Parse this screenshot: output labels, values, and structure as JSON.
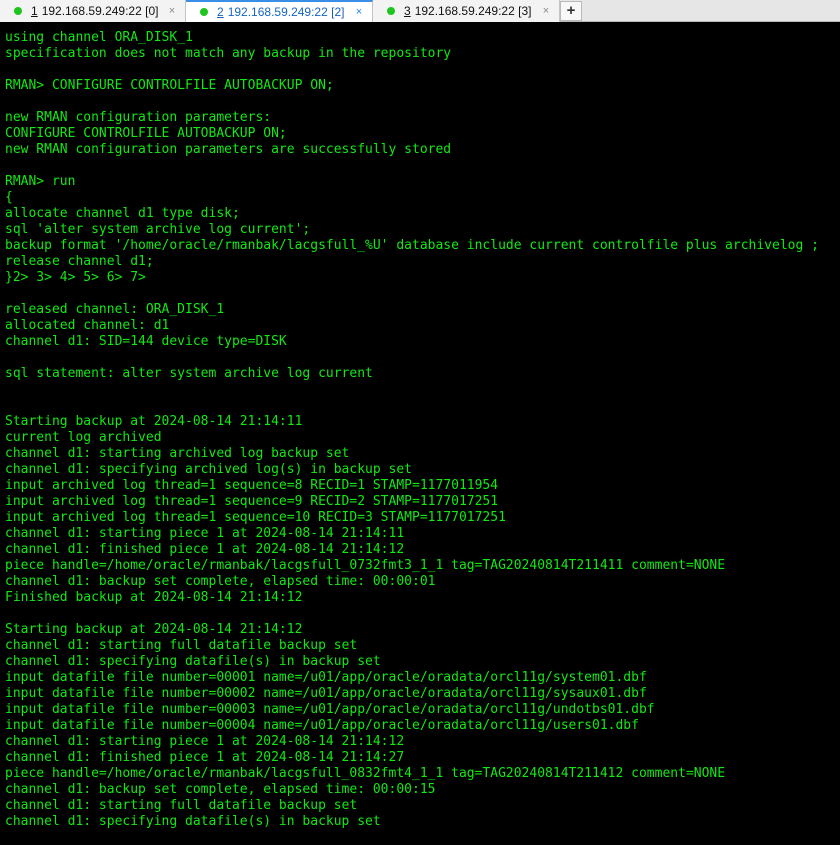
{
  "tabs": [
    {
      "number": "1",
      "label": "192.168.59.249:22 [0]",
      "close": "×",
      "status_color": "#1ec51e",
      "active": false
    },
    {
      "number": "2",
      "label": "192.168.59.249:22 [2]",
      "close": "×",
      "status_color": "#1ec51e",
      "active": true
    },
    {
      "number": "3",
      "label": "192.168.59.249:22 [3]",
      "close": "×",
      "status_color": "#1ec51e",
      "active": false
    }
  ],
  "new_tab_label": "+",
  "terminal": {
    "text_color": "#13e813",
    "background": "#000000",
    "lines": [
      "using channel ORA_DISK_1",
      "specification does not match any backup in the repository",
      "",
      "RMAN> CONFIGURE CONTROLFILE AUTOBACKUP ON;",
      "",
      "new RMAN configuration parameters:",
      "CONFIGURE CONTROLFILE AUTOBACKUP ON;",
      "new RMAN configuration parameters are successfully stored",
      "",
      "RMAN> run",
      "{",
      "allocate channel d1 type disk;",
      "sql 'alter system archive log current';",
      "backup format '/home/oracle/rmanbak/lacgsfull_%U' database include current controlfile plus archivelog ;",
      "release channel d1;",
      "}2> 3> 4> 5> 6> 7>",
      "",
      "released channel: ORA_DISK_1",
      "allocated channel: d1",
      "channel d1: SID=144 device type=DISK",
      "",
      "sql statement: alter system archive log current",
      "",
      "",
      "Starting backup at 2024-08-14 21:14:11",
      "current log archived",
      "channel d1: starting archived log backup set",
      "channel d1: specifying archived log(s) in backup set",
      "input archived log thread=1 sequence=8 RECID=1 STAMP=1177011954",
      "input archived log thread=1 sequence=9 RECID=2 STAMP=1177017251",
      "input archived log thread=1 sequence=10 RECID=3 STAMP=1177017251",
      "channel d1: starting piece 1 at 2024-08-14 21:14:11",
      "channel d1: finished piece 1 at 2024-08-14 21:14:12",
      "piece handle=/home/oracle/rmanbak/lacgsfull_0732fmt3_1_1 tag=TAG20240814T211411 comment=NONE",
      "channel d1: backup set complete, elapsed time: 00:00:01",
      "Finished backup at 2024-08-14 21:14:12",
      "",
      "Starting backup at 2024-08-14 21:14:12",
      "channel d1: starting full datafile backup set",
      "channel d1: specifying datafile(s) in backup set",
      "input datafile file number=00001 name=/u01/app/oracle/oradata/orcl11g/system01.dbf",
      "input datafile file number=00002 name=/u01/app/oracle/oradata/orcl11g/sysaux01.dbf",
      "input datafile file number=00003 name=/u01/app/oracle/oradata/orcl11g/undotbs01.dbf",
      "input datafile file number=00004 name=/u01/app/oracle/oradata/orcl11g/users01.dbf",
      "channel d1: starting piece 1 at 2024-08-14 21:14:12",
      "channel d1: finished piece 1 at 2024-08-14 21:14:27",
      "piece handle=/home/oracle/rmanbak/lacgsfull_0832fmt4_1_1 tag=TAG20240814T211412 comment=NONE",
      "channel d1: backup set complete, elapsed time: 00:00:15",
      "channel d1: starting full datafile backup set",
      "channel d1: specifying datafile(s) in backup set"
    ]
  }
}
